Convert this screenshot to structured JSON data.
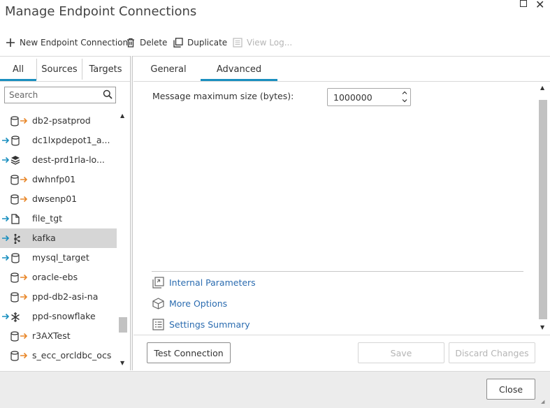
{
  "window": {
    "title": "Manage Endpoint Connections",
    "maximize_icon": "maximize-icon",
    "close_icon": "close-icon"
  },
  "toolbar": {
    "new_label": "New Endpoint Connection",
    "delete_label": "Delete",
    "duplicate_label": "Duplicate",
    "view_log_label": "View Log..."
  },
  "left_tabs": {
    "all": "All",
    "sources": "Sources",
    "targets": "Targets",
    "active": "All"
  },
  "search": {
    "placeholder": "Search"
  },
  "endpoints": [
    {
      "label": "db2-psatprod",
      "direction": "source",
      "type": "database"
    },
    {
      "label": "dc1lxpdepot1_a...",
      "direction": "target",
      "type": "database"
    },
    {
      "label": "dest-prd1rla-lo...",
      "direction": "target",
      "type": "layers"
    },
    {
      "label": "dwhnfp01",
      "direction": "source",
      "type": "database"
    },
    {
      "label": "dwsenp01",
      "direction": "source",
      "type": "database"
    },
    {
      "label": "file_tgt",
      "direction": "target",
      "type": "file"
    },
    {
      "label": "kafka",
      "direction": "target",
      "type": "kafka",
      "selected": true
    },
    {
      "label": "mysql_target",
      "direction": "target",
      "type": "database"
    },
    {
      "label": "oracle-ebs",
      "direction": "source",
      "type": "database"
    },
    {
      "label": "ppd-db2-asi-na",
      "direction": "source",
      "type": "database"
    },
    {
      "label": "ppd-snowflake",
      "direction": "target",
      "type": "snowflake"
    },
    {
      "label": "r3AXTest",
      "direction": "source",
      "type": "database"
    },
    {
      "label": "s_ecc_orcldbc_ocs",
      "direction": "source",
      "type": "database"
    }
  ],
  "right_tabs": {
    "general": "General",
    "advanced": "Advanced",
    "active": "Advanced"
  },
  "advanced": {
    "max_size_label": "Message maximum size (bytes):",
    "max_size_value": "1000000"
  },
  "links": {
    "internal_parameters": "Internal Parameters",
    "more_options": "More Options",
    "settings_summary": "Settings Summary"
  },
  "buttons": {
    "test_connection": "Test Connection",
    "save": "Save",
    "discard_changes": "Discard Changes",
    "close": "Close"
  },
  "colors": {
    "accent": "#1a8fbf",
    "source_arrow": "#e8872a",
    "target_arrow": "#1a8fbf",
    "link": "#2b6cb0"
  }
}
